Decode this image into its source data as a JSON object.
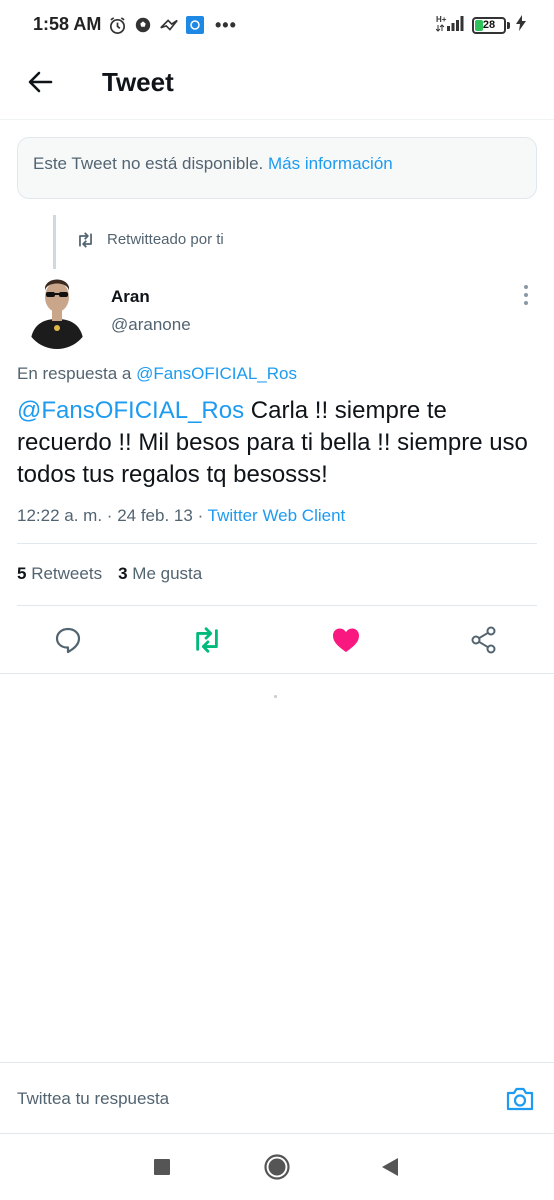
{
  "status_bar": {
    "time": "1:58 AM",
    "notification_icons": [
      "alarm-clock-icon",
      "soccer-ball-icon",
      "swoosh-icon",
      "app-square-icon"
    ],
    "more_dots": "•••",
    "network_label": "H+",
    "battery_level": "28",
    "battery_fraction": 0.28,
    "battery_color": "#2fc25b"
  },
  "header": {
    "title": "Tweet"
  },
  "notice": {
    "text": "Este Tweet no está disponible.",
    "link": "Más información"
  },
  "retweet": {
    "label": "Retwitteado por ti"
  },
  "author": {
    "name": "Aran",
    "handle": "@aranone"
  },
  "reply_context": {
    "prefix": "En respuesta a",
    "mention": "@FansOFICIAL_Ros"
  },
  "tweet": {
    "mention": "@FansOFICIAL_Ros",
    "text": " Carla !! siempre te recuerdo !! Mil besos para ti bella !! siempre uso todos tus regalos tq besosss!",
    "time": "12:22 a. m.",
    "separator": "·",
    "date": "24 feb. 13",
    "client": "Twitter Web Client"
  },
  "stats": {
    "retweets_count": "5",
    "retweets_label": "Retweets",
    "likes_count": "3",
    "likes_label": "Me gusta"
  },
  "actions": {
    "reply_icon": "reply-bubble-icon",
    "retweet_icon": "retweet-icon",
    "like_icon": "heart-icon",
    "share_icon": "share-icon"
  },
  "composer": {
    "placeholder": "Twittea tu respuesta"
  },
  "colors": {
    "accent": "#1d9bf0",
    "retweet_green": "#00ba7c",
    "like_pink": "#f91880",
    "muted_text": "#536471"
  }
}
